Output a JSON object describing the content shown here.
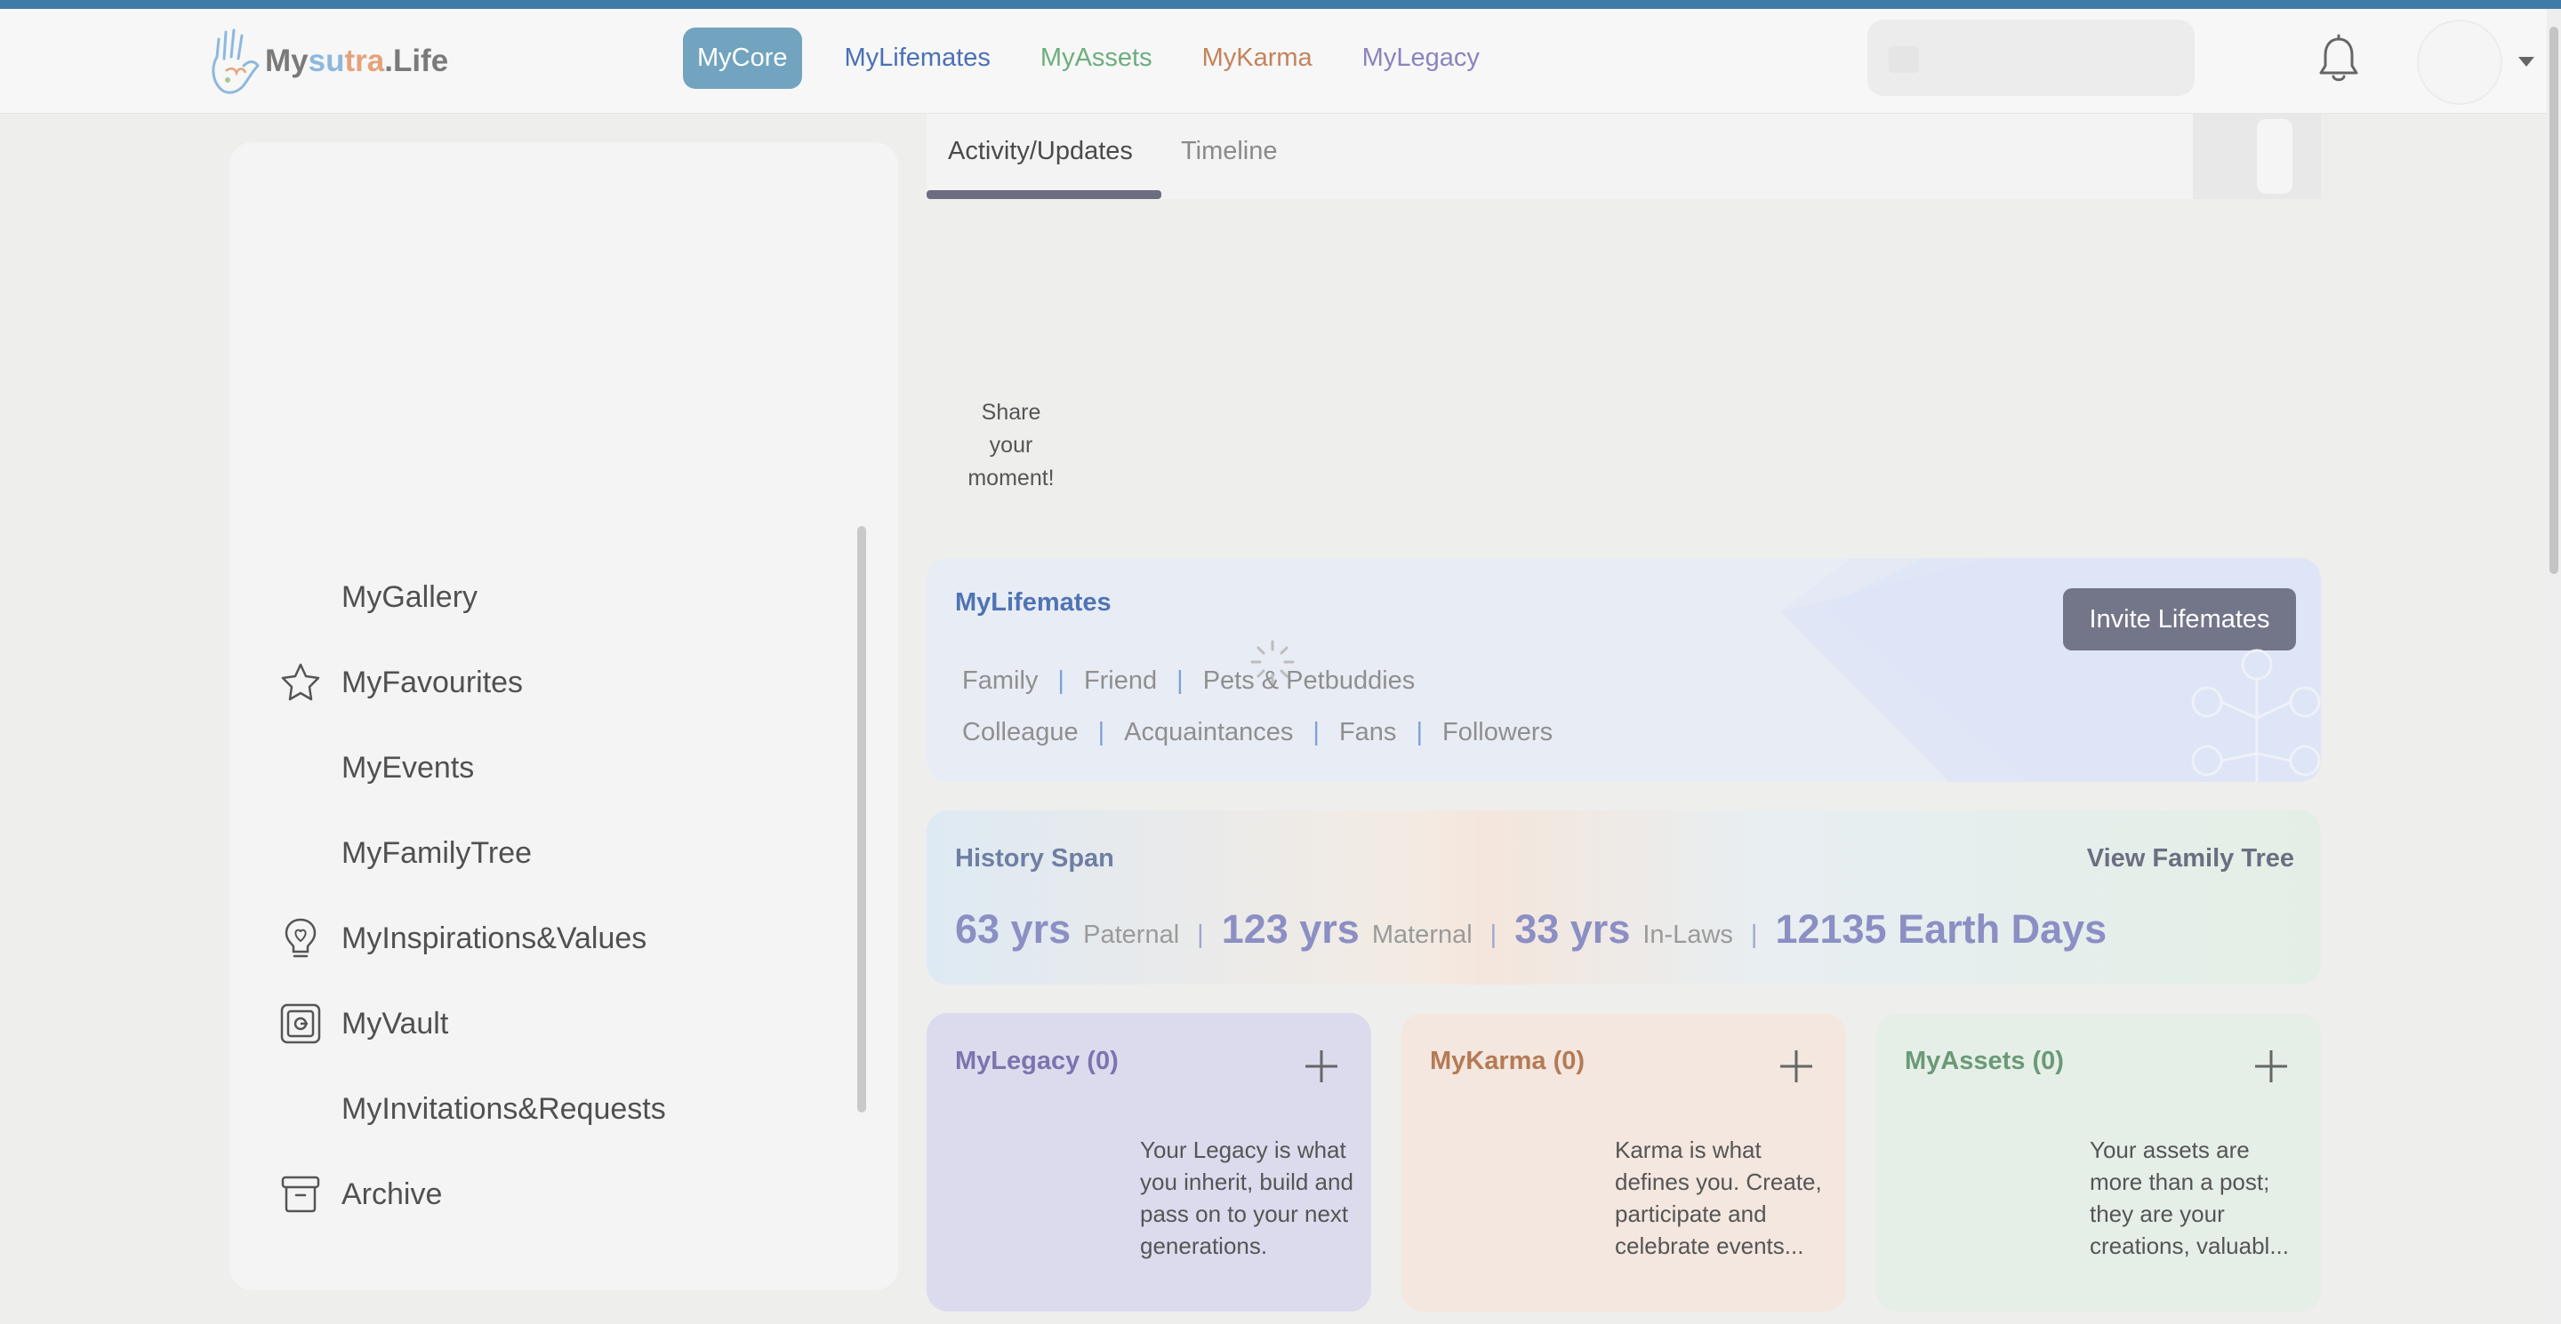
{
  "app": {
    "logo_text": "Mysutra.Life",
    "logo_parts": [
      "My",
      "su",
      "tra",
      ".Life"
    ]
  },
  "nav": {
    "items": [
      {
        "label": "MyCore",
        "active": true
      },
      {
        "label": "MyLifemates"
      },
      {
        "label": "MyAssets"
      },
      {
        "label": "MyKarma"
      },
      {
        "label": "MyLegacy"
      }
    ]
  },
  "sidebar": {
    "items": [
      {
        "label": "MyGallery",
        "icon": ""
      },
      {
        "label": "MyFavourites",
        "icon": "star-icon"
      },
      {
        "label": "MyEvents",
        "icon": ""
      },
      {
        "label": "MyFamilyTree",
        "icon": ""
      },
      {
        "label": "MyInspirations&Values",
        "icon": "lightbulb-heart-icon"
      },
      {
        "label": "MyVault",
        "icon": "vault-icon"
      },
      {
        "label": "MyInvitations&Requests",
        "icon": ""
      },
      {
        "label": "Archive",
        "icon": "archive-box-icon"
      }
    ]
  },
  "tabs": {
    "items": [
      {
        "label": "Activity/Updates",
        "active": true
      },
      {
        "label": "Timeline"
      }
    ]
  },
  "share": {
    "line1": "Share your",
    "line2": "moment!"
  },
  "lifemates": {
    "title": "MyLifemates",
    "invite_label": "Invite Lifemates",
    "row1": [
      "Family",
      "Friend",
      "Pets & Petbuddies"
    ],
    "row2": [
      "Colleague",
      "Acquaintances",
      "Fans",
      "Followers"
    ]
  },
  "history": {
    "title": "History Span",
    "link_label": "View Family Tree",
    "paternal_value": "63 yrs",
    "paternal_label": "Paternal",
    "maternal_value": "123 yrs",
    "maternal_label": "Maternal",
    "inlaws_value": "33 yrs",
    "inlaws_label": "In-Laws",
    "earth_days": "12135 Earth Days"
  },
  "cards": {
    "legacy": {
      "title": "MyLegacy (0)",
      "text": "Your Legacy is what you inherit, build and pass on to your next generations."
    },
    "karma": {
      "title": "MyKarma (0)",
      "text": "Karma is what defines you. Create, participate and celebrate events..."
    },
    "assets": {
      "title": "MyAssets (0)",
      "text": "Your assets are more than a post; they are your creations, valuabl..."
    }
  },
  "colors": {
    "top_strip": "#3f7ba8",
    "nav_active_bg": "#72a4bf",
    "lifemates_accent": "#4b70b5",
    "assets_accent": "#6cae7e",
    "karma_accent": "#c4835c",
    "legacy_accent": "#8a84bd",
    "invite_button": "#737688"
  }
}
